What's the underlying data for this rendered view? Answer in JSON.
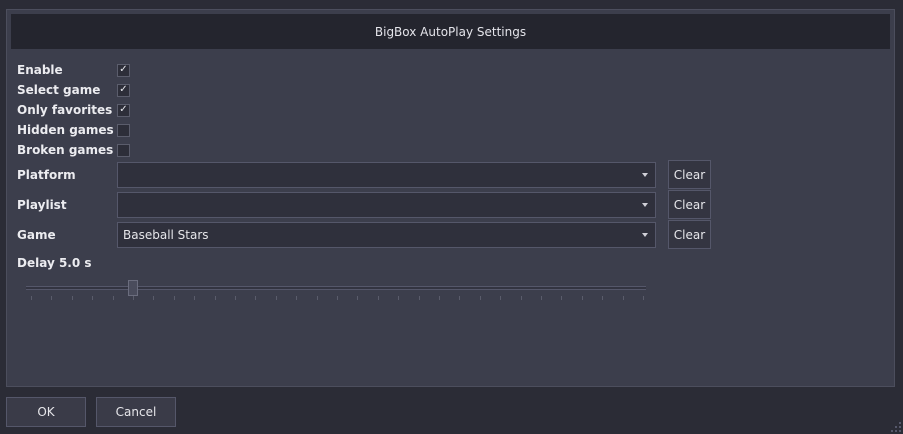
{
  "window": {
    "title": "BigBox AutoPlay Settings"
  },
  "options": [
    {
      "label": "Enable",
      "checked": true
    },
    {
      "label": "Select game",
      "checked": true
    },
    {
      "label": "Only favorites",
      "checked": true
    },
    {
      "label": "Hidden games",
      "checked": false
    },
    {
      "label": "Broken games",
      "checked": false
    }
  ],
  "fields": {
    "platform": {
      "label": "Platform",
      "value": "",
      "clear_label": "Clear"
    },
    "playlist": {
      "label": "Playlist",
      "value": "",
      "clear_label": "Clear"
    },
    "game": {
      "label": "Game",
      "value": "Baseball Stars",
      "clear_label": "Clear"
    }
  },
  "delay": {
    "label": "Delay 5.0 s",
    "value_seconds": 5.0,
    "slider_fraction": 0.17
  },
  "footer": {
    "ok_label": "OK",
    "cancel_label": "Cancel"
  },
  "icons": {
    "check": "checkmark-icon",
    "dropdown": "chevron-down-icon"
  }
}
